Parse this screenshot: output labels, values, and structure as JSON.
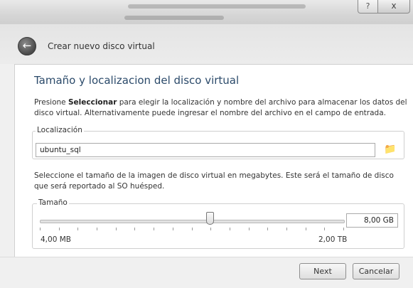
{
  "titlebar": {
    "help_label": "?",
    "close_label": "x"
  },
  "header": {
    "title": "Crear nuevo disco virtual",
    "back_icon": "back-arrow-icon"
  },
  "page": {
    "title": "Tamaño y localizacion del disco virtual",
    "intro_prefix": "Presione ",
    "intro_bold": "Seleccionar",
    "intro_suffix": " para elegir la localización y nombre del archivo para almacenar los datos del disco virtual. Alternativamente puede ingresar el nombre del archivo en el campo de entrada."
  },
  "location": {
    "legend": "Localización",
    "value": "ubuntu_sql",
    "folder_icon": "folder-icon"
  },
  "size": {
    "description": "Seleccione el tamaño de la imagen de disco virtual en megabytes. Este será el tamaño de disco que será reportado al SO huésped.",
    "legend": "Tamaño",
    "value": "8,00 GB",
    "min_label": "4,00 MB",
    "max_label": "2,00 TB",
    "slider_fraction": 0.56
  },
  "buttons": {
    "next": "Next",
    "cancel": "Cancelar"
  }
}
